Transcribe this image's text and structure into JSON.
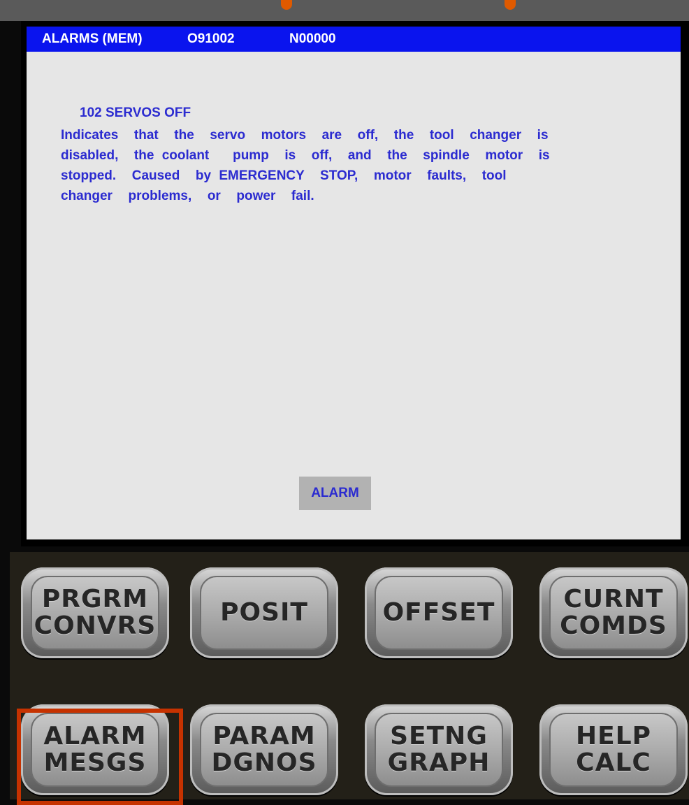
{
  "status_bar": {
    "mode": "ALARMS  (MEM)",
    "program": "O91002",
    "sequence": "N00000"
  },
  "alarm": {
    "code_title": "102  SERVOS OFF",
    "description": "Indicates  that  the  servo  motors  are  off,  the  tool  changer  is\ndisabled,  the coolant   pump  is  off,  and  the  spindle  motor  is\nstopped.  Caused  by EMERGENCY  STOP,  motor  faults,  tool\nchanger  problems,  or  power  fail."
  },
  "softkey": {
    "label": "ALARM"
  },
  "keypad": {
    "row1": [
      {
        "line1": "PRGRM",
        "line2": "CONVRS"
      },
      {
        "line1": "POSIT",
        "line2": ""
      },
      {
        "line1": "OFFSET",
        "line2": ""
      },
      {
        "line1": "CURNT",
        "line2": "COMDS"
      }
    ],
    "row2": [
      {
        "line1": "ALARM",
        "line2": "MESGS"
      },
      {
        "line1": "PARAM",
        "line2": "DGNOS"
      },
      {
        "line1": "SETNG",
        "line2": "GRAPH"
      },
      {
        "line1": "HELP",
        "line2": "CALC"
      }
    ]
  },
  "colors": {
    "status_bar_bg": "#0a14ee",
    "text_blue": "#2b2bd0",
    "display_bg": "#e6e6e6",
    "highlight": "#c63200"
  }
}
